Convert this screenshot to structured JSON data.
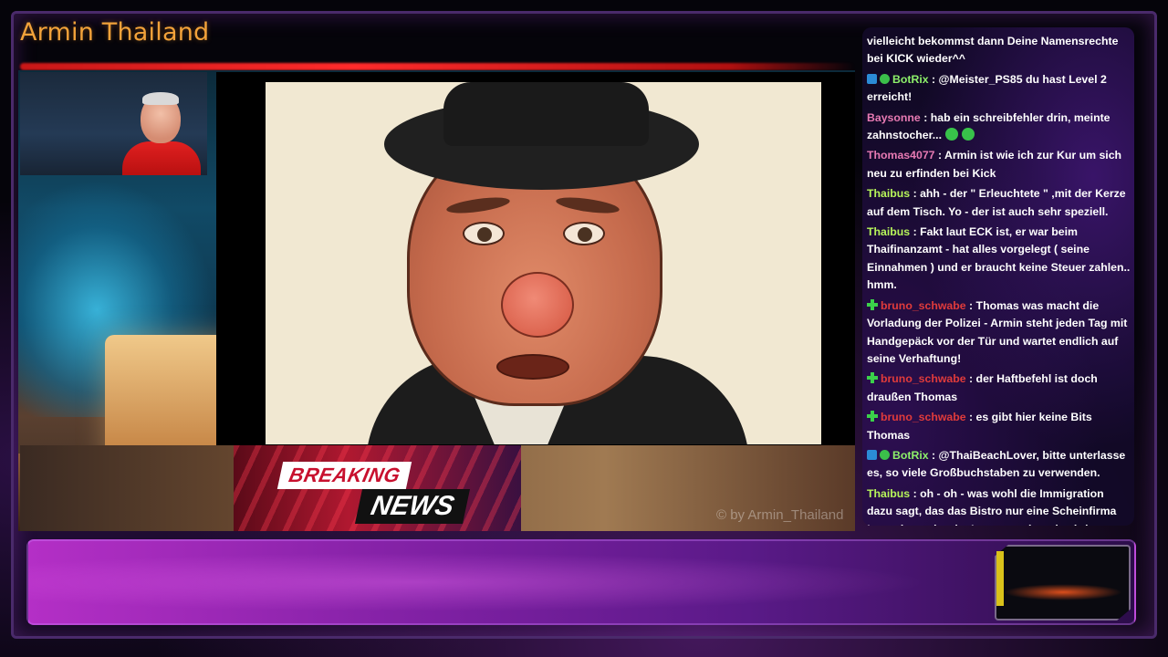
{
  "channel": {
    "title": "Armin Thailand"
  },
  "stream": {
    "breaking_label": "BREAKING",
    "news_label": "NEWS",
    "watermark": "© by Armin_Thailand"
  },
  "chat": {
    "messages": [
      {
        "badges": [],
        "user": "",
        "user_color": "#ffffff",
        "text": "vielleicht bekommst dann Deine Namensrechte bei KICK wieder^^"
      },
      {
        "badges": [
          "bot-icon",
          "verified-icon"
        ],
        "user": "BotRix",
        "user_color": "#8df06a",
        "text": ": @Meister_PS85 du hast Level 2 erreicht!"
      },
      {
        "badges": [],
        "user": "Baysonne",
        "user_color": "#e77ab3",
        "text": ": hab ein schreibfehler drin, meinte zahnstocher...",
        "emotes": 2
      },
      {
        "badges": [],
        "user": "Thomas4077",
        "user_color": "#e77ab3",
        "text": ": Armin ist wie ich zur Kur um sich neu zu erfinden bei Kick"
      },
      {
        "badges": [],
        "user": "Thaibus",
        "user_color": "#b7f55a",
        "text": ": ahh - der \" Erleuchtete \" ,mit der Kerze auf dem Tisch. Yo - der ist auch sehr speziell."
      },
      {
        "badges": [],
        "user": "Thaibus",
        "user_color": "#b7f55a",
        "text": ": Fakt laut ECK ist, er war beim Thaifinanzamt - hat alles vorgelegt ( seine Einnahmen ) und er braucht keine Steuer zahlen.. hmm."
      },
      {
        "badges": [
          "subscriber-icon"
        ],
        "user": "bruno_schwabe",
        "user_color": "#e03b3b",
        "text": ": Thomas was macht die Vorladung der Polizei - Armin steht jeden Tag mit Handgepäck vor der Tür und wartet endlich auf seine Verhaftung!"
      },
      {
        "badges": [
          "subscriber-icon"
        ],
        "user": "bruno_schwabe",
        "user_color": "#e03b3b",
        "text": ": der Haftbefehl ist doch draußen Thomas"
      },
      {
        "badges": [
          "subscriber-icon"
        ],
        "user": "bruno_schwabe",
        "user_color": "#e03b3b",
        "text": ": es gibt hier keine Bits Thomas"
      },
      {
        "badges": [
          "bot-icon",
          "verified-icon"
        ],
        "user": "BotRix",
        "user_color": "#8df06a",
        "text": ": @ThaiBeachLover, bitte unterlasse es, so viele Großbuchstaben zu verwenden."
      },
      {
        "badges": [],
        "user": "Thaibus",
        "user_color": "#b7f55a",
        "text": ": oh - oh - was wohl die Immigration dazu sagt, das das Bistro nur eine Scheinfirma ist und von dort im Internet gebettelt wird.."
      }
    ]
  },
  "colors": {
    "title": "#f2a23a",
    "accent_red": "#c8102e",
    "panel_purple": "#7a1fa0"
  }
}
